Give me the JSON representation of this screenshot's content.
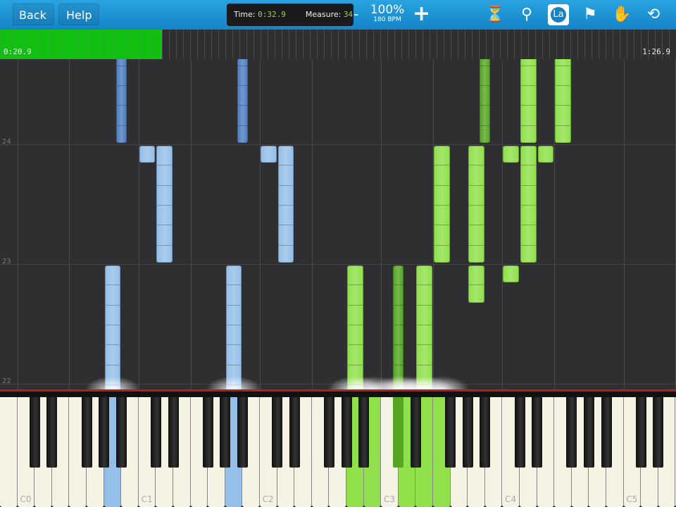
{
  "header": {
    "back": "Back",
    "help": "Help",
    "time_label": "Time:",
    "time_value": "0:32.9",
    "measure_label": "Measure:",
    "measure_value": "34",
    "minus": "-",
    "speed": "100%",
    "bpm": "180 BPM",
    "plus": "+",
    "icons": [
      "metronome-icon",
      "zoom-icon",
      "note-labels-icon",
      "bookmark-icon",
      "hand-icon",
      "loop-icon"
    ],
    "la": "La"
  },
  "timeline": {
    "start": "0:20.9",
    "end": "1:26.9",
    "progress": 0.24
  },
  "measures": [
    {
      "label": "22",
      "t": 0
    },
    {
      "label": "23",
      "t": 6
    },
    {
      "label": "24",
      "t": 12
    }
  ],
  "key_labels": [
    {
      "label": "C0",
      "key": 1
    },
    {
      "label": "C1",
      "key": 8
    },
    {
      "label": "C2",
      "key": 15
    },
    {
      "label": "C3",
      "key": 22
    },
    {
      "label": "C4",
      "key": 29
    },
    {
      "label": "C5",
      "key": 36
    }
  ],
  "colors": {
    "blue": "#94bfe8",
    "blue_dark": "#4f7fc0",
    "green": "#8fe04a",
    "green_dark": "#56a624"
  },
  "notes": [
    {
      "hand": "left",
      "key": 6,
      "black": true,
      "start": 12,
      "len": 6
    },
    {
      "hand": "left",
      "key": 8,
      "black": false,
      "start": 11,
      "len": 1
    },
    {
      "hand": "left",
      "key": 9,
      "black": false,
      "start": 6,
      "len": 6
    },
    {
      "hand": "left",
      "key": 13,
      "black": true,
      "start": 12,
      "len": 6
    },
    {
      "hand": "left",
      "key": 15,
      "black": false,
      "start": 11,
      "len": 1
    },
    {
      "hand": "left",
      "key": 16,
      "black": false,
      "start": 6,
      "len": 6
    },
    {
      "hand": "left",
      "key": 6,
      "black": false,
      "start": -0.5,
      "len": 6.5
    },
    {
      "hand": "left",
      "key": 13,
      "black": false,
      "start": -0.5,
      "len": 6.5
    },
    {
      "hand": "right",
      "key": 27,
      "black": true,
      "start": 12,
      "len": 6
    },
    {
      "hand": "right",
      "key": 30,
      "black": false,
      "start": 12,
      "len": 6
    },
    {
      "hand": "right",
      "key": 32,
      "black": false,
      "start": 12,
      "len": 6
    },
    {
      "hand": "right",
      "key": 25,
      "black": false,
      "start": 6,
      "len": 6
    },
    {
      "hand": "right",
      "key": 27,
      "black": false,
      "start": 6,
      "len": 6
    },
    {
      "hand": "right",
      "key": 29,
      "black": false,
      "start": 11,
      "len": 1
    },
    {
      "hand": "right",
      "key": 30,
      "black": false,
      "start": 6,
      "len": 6
    },
    {
      "hand": "right",
      "key": 31,
      "black": false,
      "start": 11,
      "len": 1
    },
    {
      "hand": "right",
      "key": 27,
      "black": false,
      "start": 4,
      "len": 2
    },
    {
      "hand": "right",
      "key": 29,
      "black": false,
      "start": 5,
      "len": 1
    },
    {
      "hand": "right",
      "key": 20,
      "black": false,
      "start": -0.5,
      "len": 6.5
    },
    {
      "hand": "right",
      "key": 22,
      "black": true,
      "start": -0.5,
      "len": 6.5
    },
    {
      "hand": "right",
      "key": 24,
      "black": false,
      "start": -0.5,
      "len": 6.5
    }
  ],
  "pressed": [
    {
      "key": 6,
      "black": false,
      "hand": "left"
    },
    {
      "key": 13,
      "black": false,
      "hand": "left"
    },
    {
      "key": 20,
      "black": false,
      "hand": "right"
    },
    {
      "key": 21,
      "black": false,
      "hand": "right"
    },
    {
      "key": 22,
      "black": true,
      "hand": "right"
    },
    {
      "key": 23,
      "black": false,
      "hand": "right"
    },
    {
      "key": 24,
      "black": false,
      "hand": "right"
    },
    {
      "key": 25,
      "black": false,
      "hand": "right"
    }
  ]
}
